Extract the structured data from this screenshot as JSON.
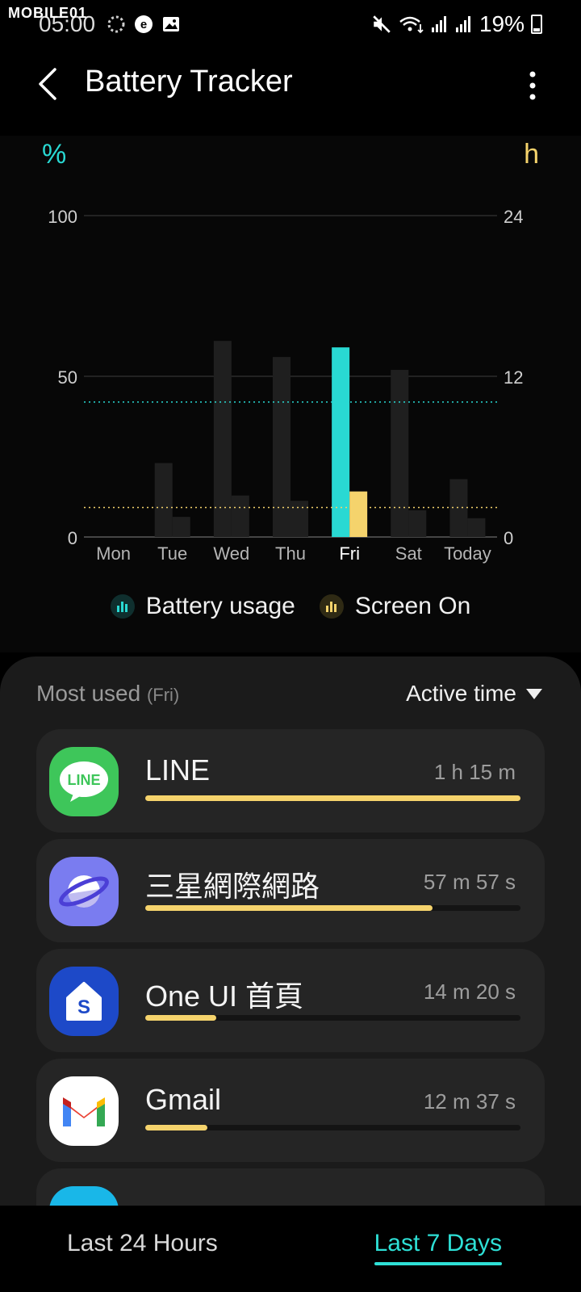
{
  "status_bar": {
    "watermark": "MOBILE01",
    "time": "05:00",
    "battery": "19%"
  },
  "app_bar": {
    "title": "Battery Tracker"
  },
  "chart_data": {
    "type": "bar",
    "categories": [
      "Mon",
      "Tue",
      "Wed",
      "Thu",
      "Fri",
      "Sat",
      "Today"
    ],
    "series": [
      {
        "name": "Battery usage",
        "axis": "left",
        "values": [
          0,
          23,
          61,
          56,
          59,
          52,
          18
        ],
        "color": "#29d9d3"
      },
      {
        "name": "Screen On",
        "axis": "right",
        "values": [
          0,
          1.5,
          3.1,
          2.7,
          3.4,
          2.0,
          1.4
        ],
        "color": "#f5d36c"
      }
    ],
    "selected_category": "Fri",
    "inactive_color": "#1f1f1f",
    "left_axis": {
      "label": "%",
      "ticks": [
        "0",
        "50",
        "100"
      ],
      "range": [
        0,
        100
      ],
      "color": "#29d9d3"
    },
    "right_axis": {
      "label": "h",
      "ticks": [
        "0",
        "12",
        "24"
      ],
      "range": [
        0,
        24
      ],
      "color": "#f5d36c"
    },
    "avg_battery_percent": 42,
    "avg_screen_hours": 2.2,
    "grid": true,
    "legend": [
      "Battery usage",
      "Screen On"
    ]
  },
  "most_used": {
    "label": "Most used",
    "day": "(Fri)",
    "sort_label": "Active time",
    "apps": [
      {
        "name": "LINE",
        "time": "1 h 15 m",
        "fraction": 1.0,
        "icon": "line-app-icon",
        "icon_text": "LINE",
        "color": "#3ec65a"
      },
      {
        "name": "三星網際網路",
        "time": "57 m 57 s",
        "fraction": 0.765,
        "icon": "samsung-internet-icon",
        "color": "#7a7cf0"
      },
      {
        "name": "One UI 首頁",
        "time": "14 m 20 s",
        "fraction": 0.19,
        "icon": "one-ui-home-icon",
        "icon_text": "S",
        "color": "#1d49c8"
      },
      {
        "name": "Gmail",
        "time": "12 m 37 s",
        "fraction": 0.165,
        "icon": "gmail-icon",
        "color": "#ffffff"
      }
    ]
  },
  "tabs": {
    "last24": "Last 24 Hours",
    "last7": "Last 7 Days"
  }
}
